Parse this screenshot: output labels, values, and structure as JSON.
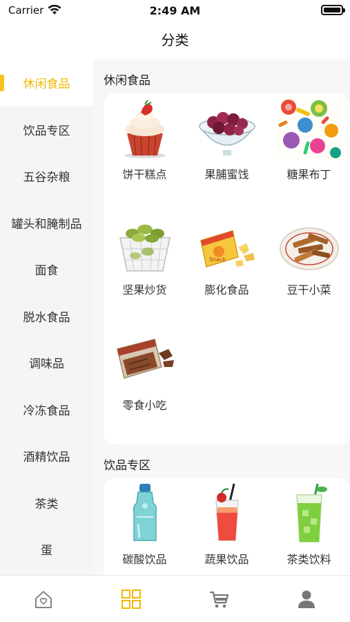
{
  "status_bar": {
    "carrier": "Carrier",
    "time": "2:49 AM"
  },
  "nav": {
    "title": "分类"
  },
  "sidebar": {
    "items": [
      {
        "label": "休闲食品",
        "active": true
      },
      {
        "label": "饮品专区"
      },
      {
        "label": "五谷杂粮"
      },
      {
        "label": "罐头和腌制品"
      },
      {
        "label": "面食"
      },
      {
        "label": "脱水食品"
      },
      {
        "label": "调味品"
      },
      {
        "label": "冷冻食品"
      },
      {
        "label": "酒精饮品"
      },
      {
        "label": "茶类"
      },
      {
        "label": "蛋"
      }
    ]
  },
  "sections": [
    {
      "title": "休闲食品",
      "items": [
        {
          "label": "饼干糕点",
          "icon": "cupcake-icon"
        },
        {
          "label": "果脯蜜饯",
          "icon": "candied-fruit-bowl-icon"
        },
        {
          "label": "糖果布丁",
          "icon": "candy-icon"
        },
        {
          "label": "坚果炒货",
          "icon": "nuts-basket-icon"
        },
        {
          "label": "膨化食品",
          "icon": "chips-bag-icon"
        },
        {
          "label": "豆干小菜",
          "icon": "tofu-strips-plate-icon"
        },
        {
          "label": "零食小吃",
          "icon": "snack-pack-icon"
        }
      ]
    },
    {
      "title": "饮品专区",
      "items": [
        {
          "label": "碳酸饮品",
          "icon": "soda-bottle-icon"
        },
        {
          "label": "蔬果饮品",
          "icon": "fruit-cocktail-icon"
        },
        {
          "label": "茶类饮料",
          "icon": "iced-tea-glass-icon"
        }
      ]
    }
  ],
  "tab_bar": {
    "tabs": [
      {
        "name": "home",
        "icon": "home-heart-icon",
        "active": false
      },
      {
        "name": "category",
        "icon": "grid-icon",
        "active": true
      },
      {
        "name": "cart",
        "icon": "cart-icon",
        "active": false
      },
      {
        "name": "profile",
        "icon": "user-icon",
        "active": false
      }
    ]
  },
  "colors": {
    "accent": "#f7c21b",
    "active_text": "#f2b705",
    "sidebar_bg": "#f5f5f5",
    "inactive_icon": "#777777"
  }
}
